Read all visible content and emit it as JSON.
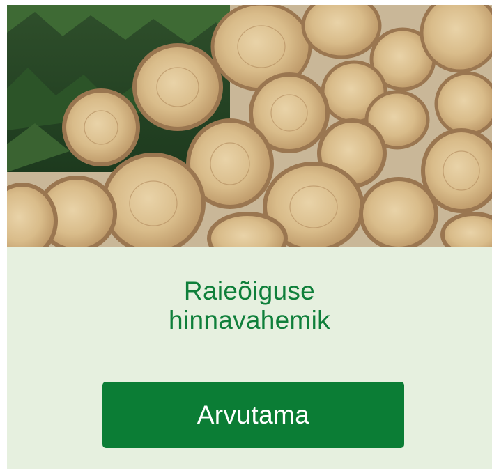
{
  "card": {
    "image": {
      "description_icon": "log-pile-photo"
    },
    "title_line1": "Raieõiguse",
    "title_line2": "hinnavahemik",
    "button_label": "Arvutama"
  },
  "colors": {
    "accent": "#0b7d35",
    "title_text": "#0f7f3a",
    "card_background": "#e6f0df"
  }
}
